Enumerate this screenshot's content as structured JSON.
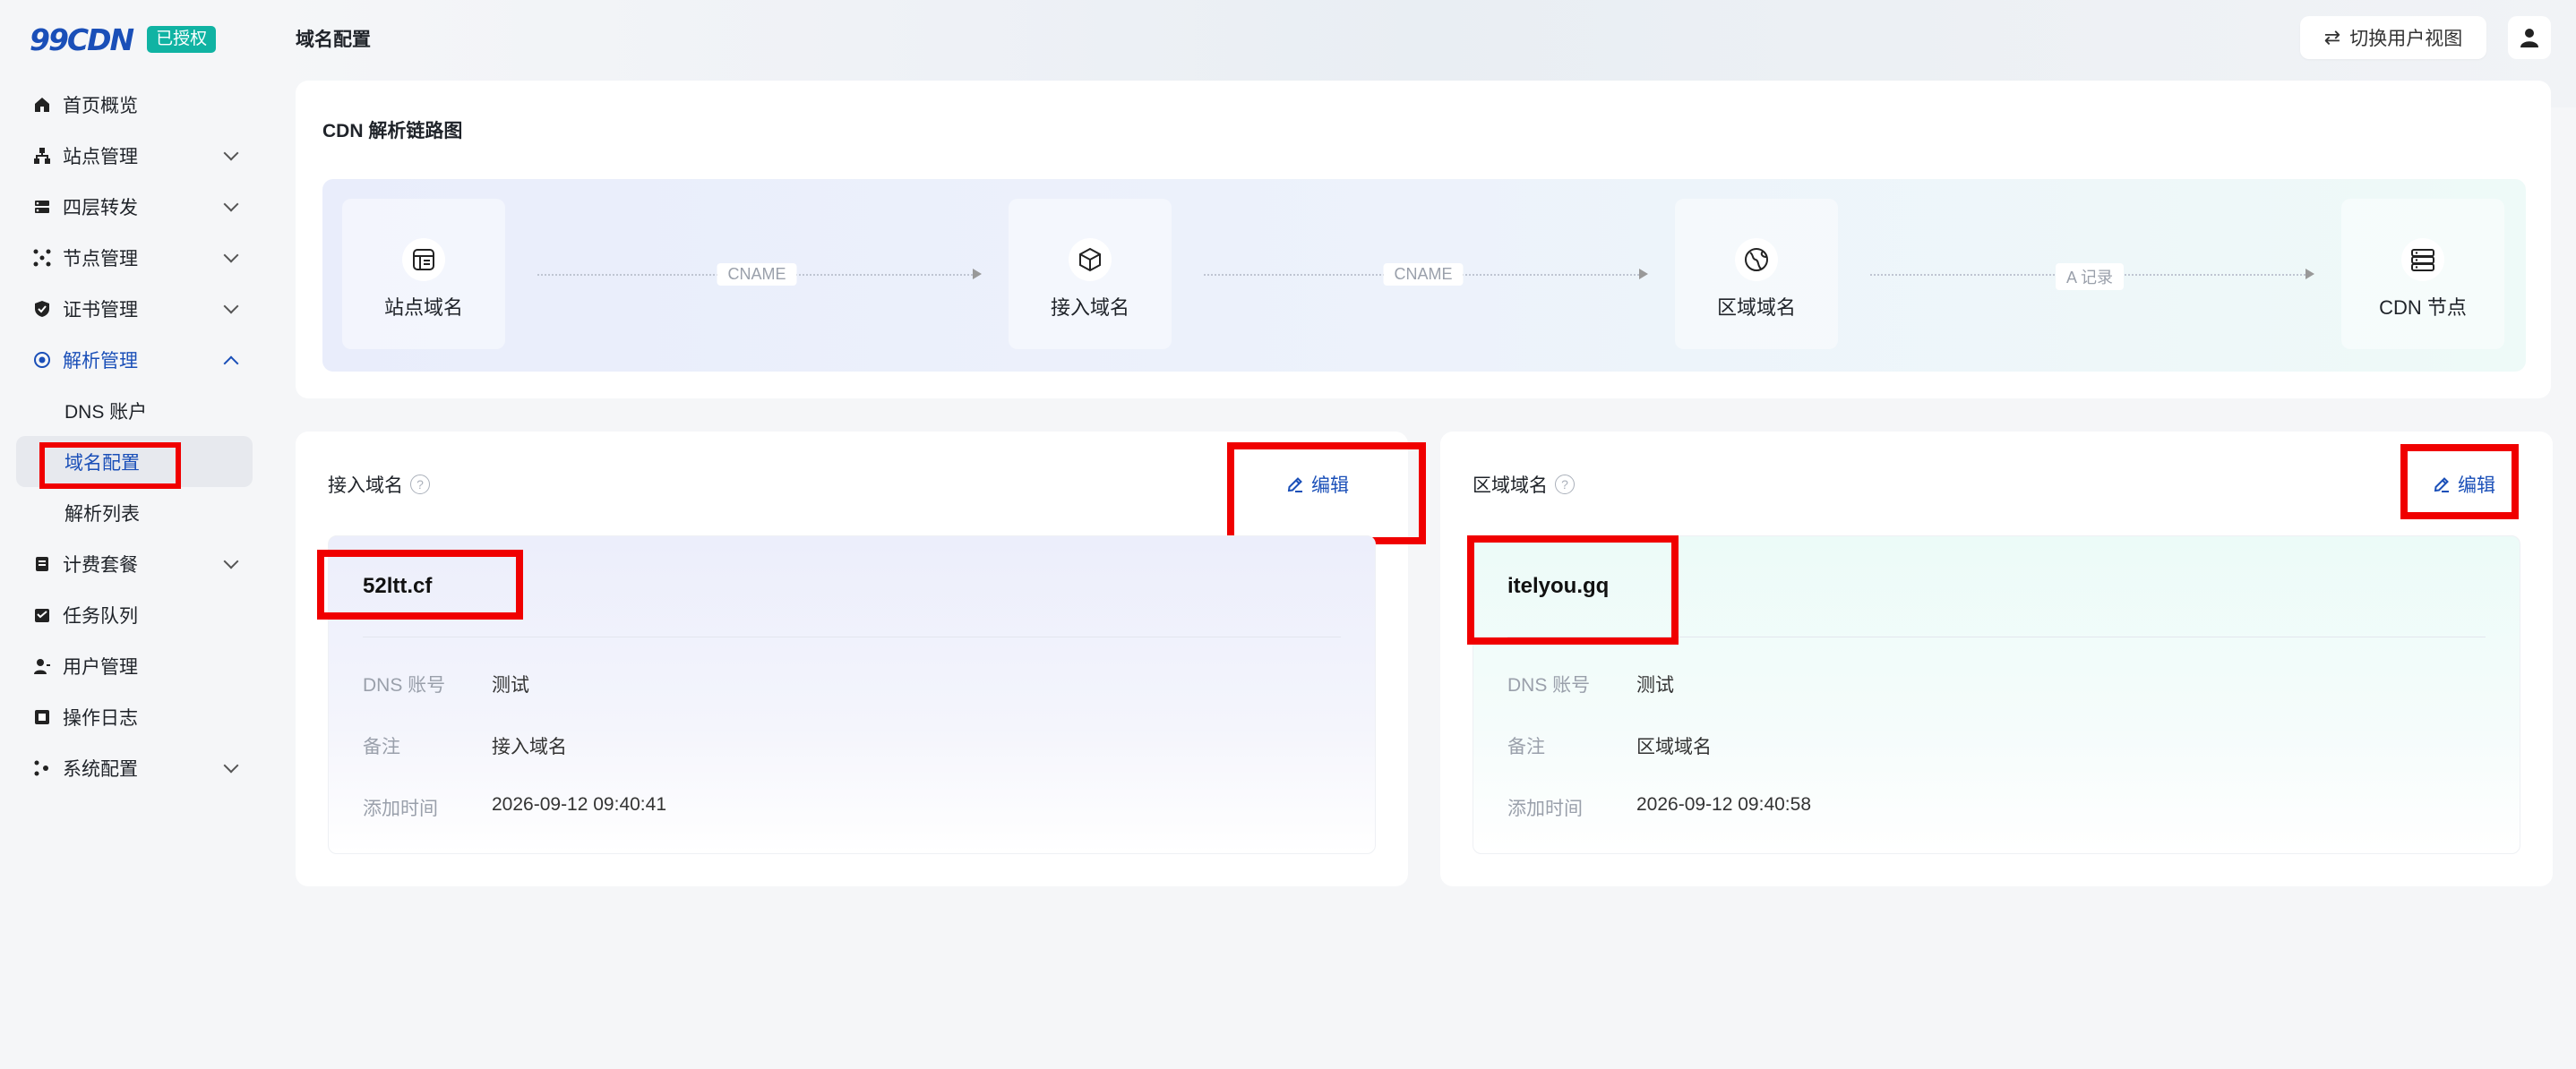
{
  "brand": {
    "logo": "99CDN",
    "badge": "已授权"
  },
  "sidebar": {
    "items": [
      {
        "label": "首页概览"
      },
      {
        "label": "站点管理"
      },
      {
        "label": "四层转发"
      },
      {
        "label": "节点管理"
      },
      {
        "label": "证书管理"
      },
      {
        "label": "解析管理"
      },
      {
        "label": "计费套餐"
      },
      {
        "label": "任务队列"
      },
      {
        "label": "用户管理"
      },
      {
        "label": "操作日志"
      },
      {
        "label": "系统配置"
      }
    ],
    "sub_items": [
      {
        "label": "DNS 账户"
      },
      {
        "label": "域名配置"
      },
      {
        "label": "解析列表"
      }
    ]
  },
  "header": {
    "title": "域名配置",
    "switch_label": "切换用户视图"
  },
  "flow": {
    "title": "CDN 解析链路图",
    "nodes": [
      {
        "label": "站点域名",
        "icon": "site-domain-icon"
      },
      {
        "label": "接入域名",
        "icon": "access-domain-icon"
      },
      {
        "label": "区域域名",
        "icon": "region-domain-icon"
      },
      {
        "label": "CDN 节点",
        "icon": "server-icon"
      }
    ],
    "links": [
      {
        "label": "CNAME"
      },
      {
        "label": "CNAME"
      },
      {
        "label": "A 记录"
      }
    ]
  },
  "access_card": {
    "title": "接入域名",
    "edit_label": "编辑",
    "domain": "52ltt.cf",
    "fields": [
      {
        "key": "DNS 账号",
        "value": "测试"
      },
      {
        "key": "备注",
        "value": "接入域名"
      },
      {
        "key": "添加时间",
        "value": "2026-09-12 09:40:41"
      }
    ]
  },
  "region_card": {
    "title": "区域域名",
    "edit_label": "编辑",
    "domain": "itelyou.gq",
    "fields": [
      {
        "key": "DNS 账号",
        "value": "测试"
      },
      {
        "key": "备注",
        "value": "区域域名"
      },
      {
        "key": "添加时间",
        "value": "2026-09-12 09:40:58"
      }
    ]
  },
  "colors": {
    "accent": "#1a4fb8",
    "badge": "#10b3a3",
    "highlight": "#f00000"
  }
}
